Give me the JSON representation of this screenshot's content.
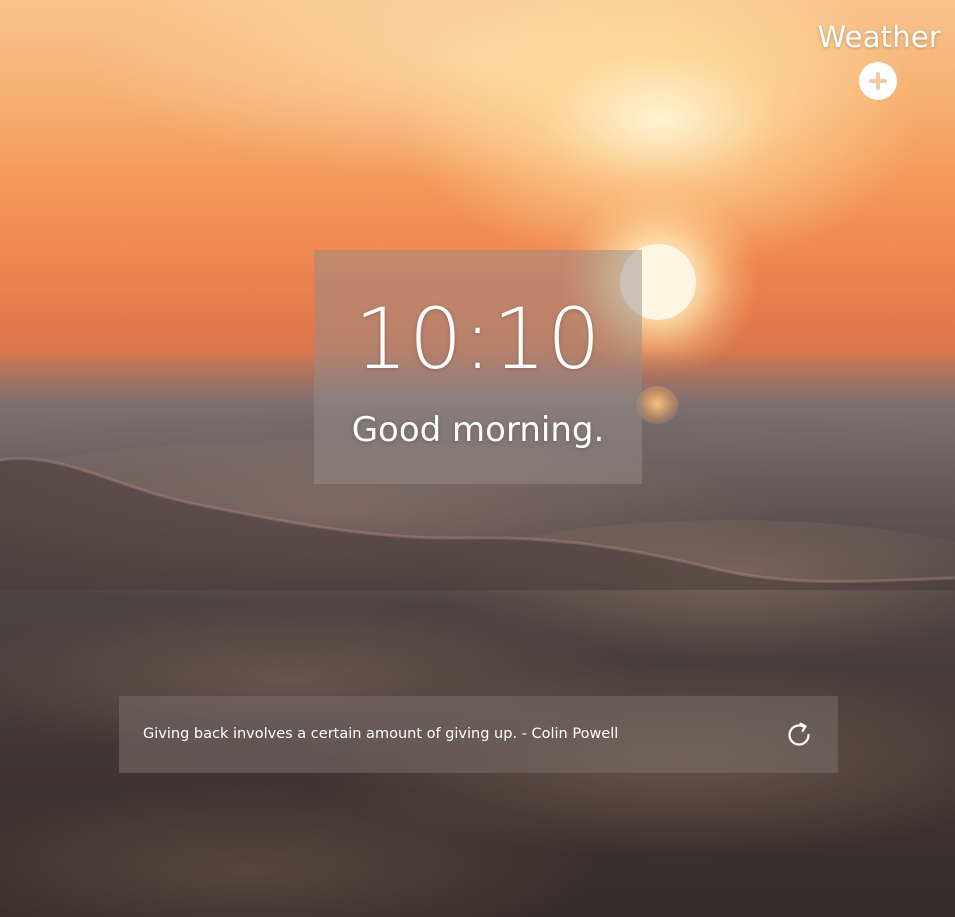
{
  "weather": {
    "title": "Weather",
    "add_icon": "plus-icon"
  },
  "clock": {
    "time": "10:10",
    "greeting": "Good morning."
  },
  "quote": {
    "text": "Giving back involves a certain amount of giving up. - Colin Powell",
    "refresh_icon": "refresh-icon"
  },
  "colors": {
    "panel_overlay": "#968c8a",
    "text": "#ffffff",
    "sky_top": "#f8c48c",
    "sky_horizon": "#e4794a",
    "sea": "#3f3635"
  },
  "background": {
    "scene": "sunset-over-ocean-waves"
  }
}
